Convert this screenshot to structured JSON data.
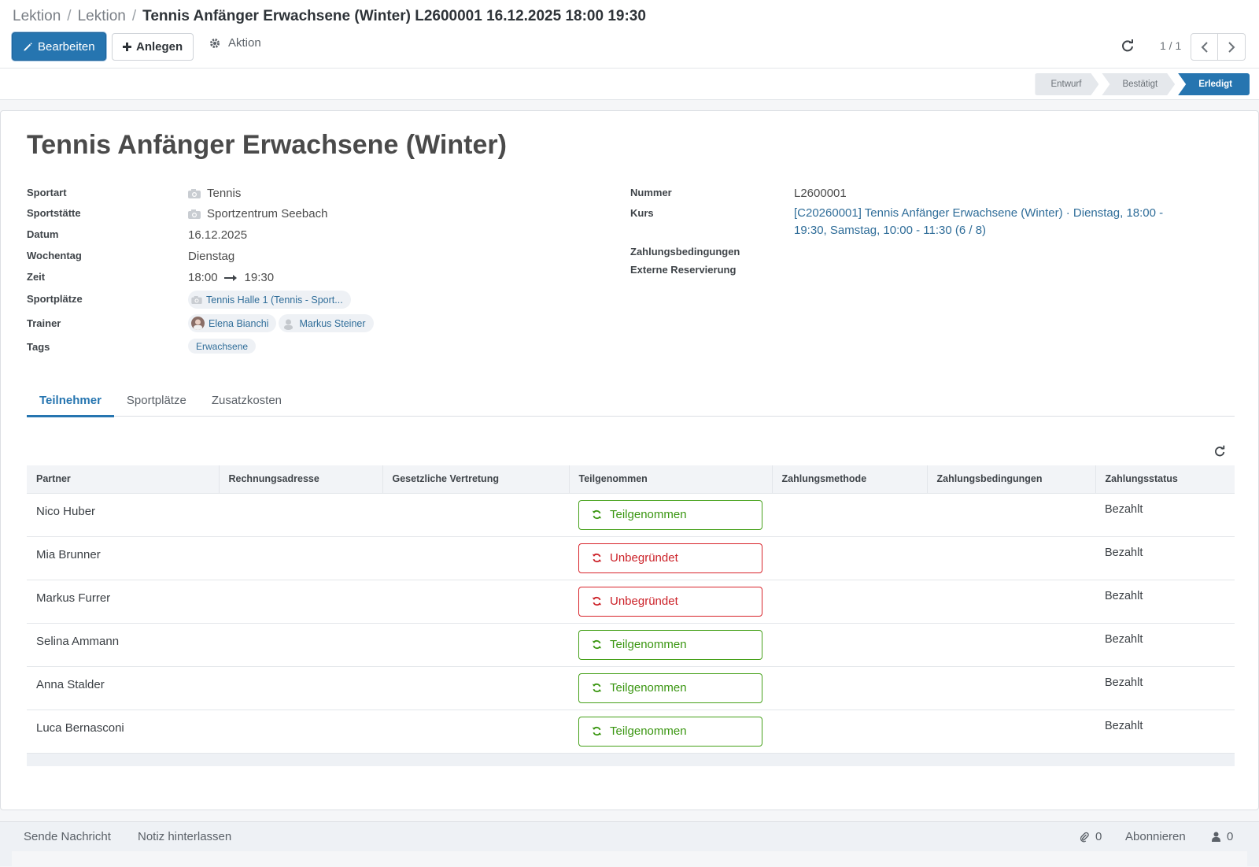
{
  "breadcrumb": {
    "items": [
      "Lektion",
      "Lektion"
    ],
    "current": "Tennis Anfänger Erwachsene (Winter) L2600001 16.12.2025 18:00 19:30"
  },
  "toolbar": {
    "edit_label": "Bearbeiten",
    "create_label": "Anlegen",
    "action_label": "Aktion"
  },
  "pager": {
    "value": "1 / 1"
  },
  "statusbar": {
    "stages": [
      "Entwurf",
      "Bestätigt",
      "Erledigt"
    ],
    "active": "Erledigt"
  },
  "record": {
    "title": "Tennis Anfänger Erwachsene (Winter)",
    "left_fields": {
      "sport": {
        "label": "Sportart",
        "value": "Tennis"
      },
      "venue": {
        "label": "Sportstätte",
        "value": "Sportzentrum Seebach"
      },
      "date": {
        "label": "Datum",
        "value": "16.12.2025"
      },
      "weekday": {
        "label": "Wochentag",
        "value": "Dienstag"
      },
      "time": {
        "label": "Zeit",
        "start": "18:00",
        "end": "19:30"
      },
      "courts": {
        "label": "Sportplätze",
        "chips": [
          "Tennis Halle 1 (Tennis - Sport..."
        ]
      },
      "trainer": {
        "label": "Trainer",
        "chips": [
          "Elena Bianchi",
          "Markus Steiner"
        ]
      },
      "tags": {
        "label": "Tags",
        "chips": [
          "Erwachsene"
        ]
      }
    },
    "right_fields": {
      "number": {
        "label": "Nummer",
        "value": "L2600001"
      },
      "course": {
        "label": "Kurs",
        "line1": "[C20260001] Tennis Anfänger Erwachsene (Winter) · Dienstag, 18:00 -",
        "line2": "19:30, Samstag, 10:00 - 11:30 (6 / 8)"
      },
      "payment_terms": {
        "label": "Zahlungsbedingungen",
        "value": ""
      },
      "external_reservation": {
        "label": "Externe Reservierung",
        "value": ""
      }
    }
  },
  "tabs": [
    "Teilnehmer",
    "Sportplätze",
    "Zusatzkosten"
  ],
  "active_tab": "Teilnehmer",
  "participants": {
    "columns": [
      "Partner",
      "Rechnungsadresse",
      "Gesetzliche Vertretung",
      "Teilgenommen",
      "Zahlungsmethode",
      "Zahlungsbedingungen",
      "Zahlungsstatus"
    ],
    "rows": [
      {
        "partner": "Nico Huber",
        "attendance": "Teilgenommen",
        "attended": true,
        "payment_status": "Bezahlt"
      },
      {
        "partner": "Mia Brunner",
        "attendance": "Unbegründet",
        "attended": false,
        "payment_status": "Bezahlt"
      },
      {
        "partner": "Markus Furrer",
        "attendance": "Unbegründet",
        "attended": false,
        "payment_status": "Bezahlt"
      },
      {
        "partner": "Selina Ammann",
        "attendance": "Teilgenommen",
        "attended": true,
        "payment_status": "Bezahlt"
      },
      {
        "partner": "Anna Stalder",
        "attendance": "Teilgenommen",
        "attended": true,
        "payment_status": "Bezahlt"
      },
      {
        "partner": "Luca Bernasconi",
        "attendance": "Teilgenommen",
        "attended": true,
        "payment_status": "Bezahlt"
      }
    ]
  },
  "chatter": {
    "send_message": "Sende Nachricht",
    "log_note": "Notiz hinterlassen",
    "attachments_count": "0",
    "follow_label": "Abonnieren",
    "followers_count": "0"
  },
  "colors": {
    "primary": "#2675b0",
    "success": "#46a11a",
    "danger": "#d8242b",
    "link": "#2f6d99"
  },
  "icons": {
    "edit": "pencil-icon",
    "create": "plus-icon",
    "action": "gear-icon",
    "reload": "refresh-icon",
    "prev": "chevron-left-icon",
    "next": "chevron-right-icon",
    "attachment": "paperclip-icon",
    "followers": "user-icon"
  }
}
